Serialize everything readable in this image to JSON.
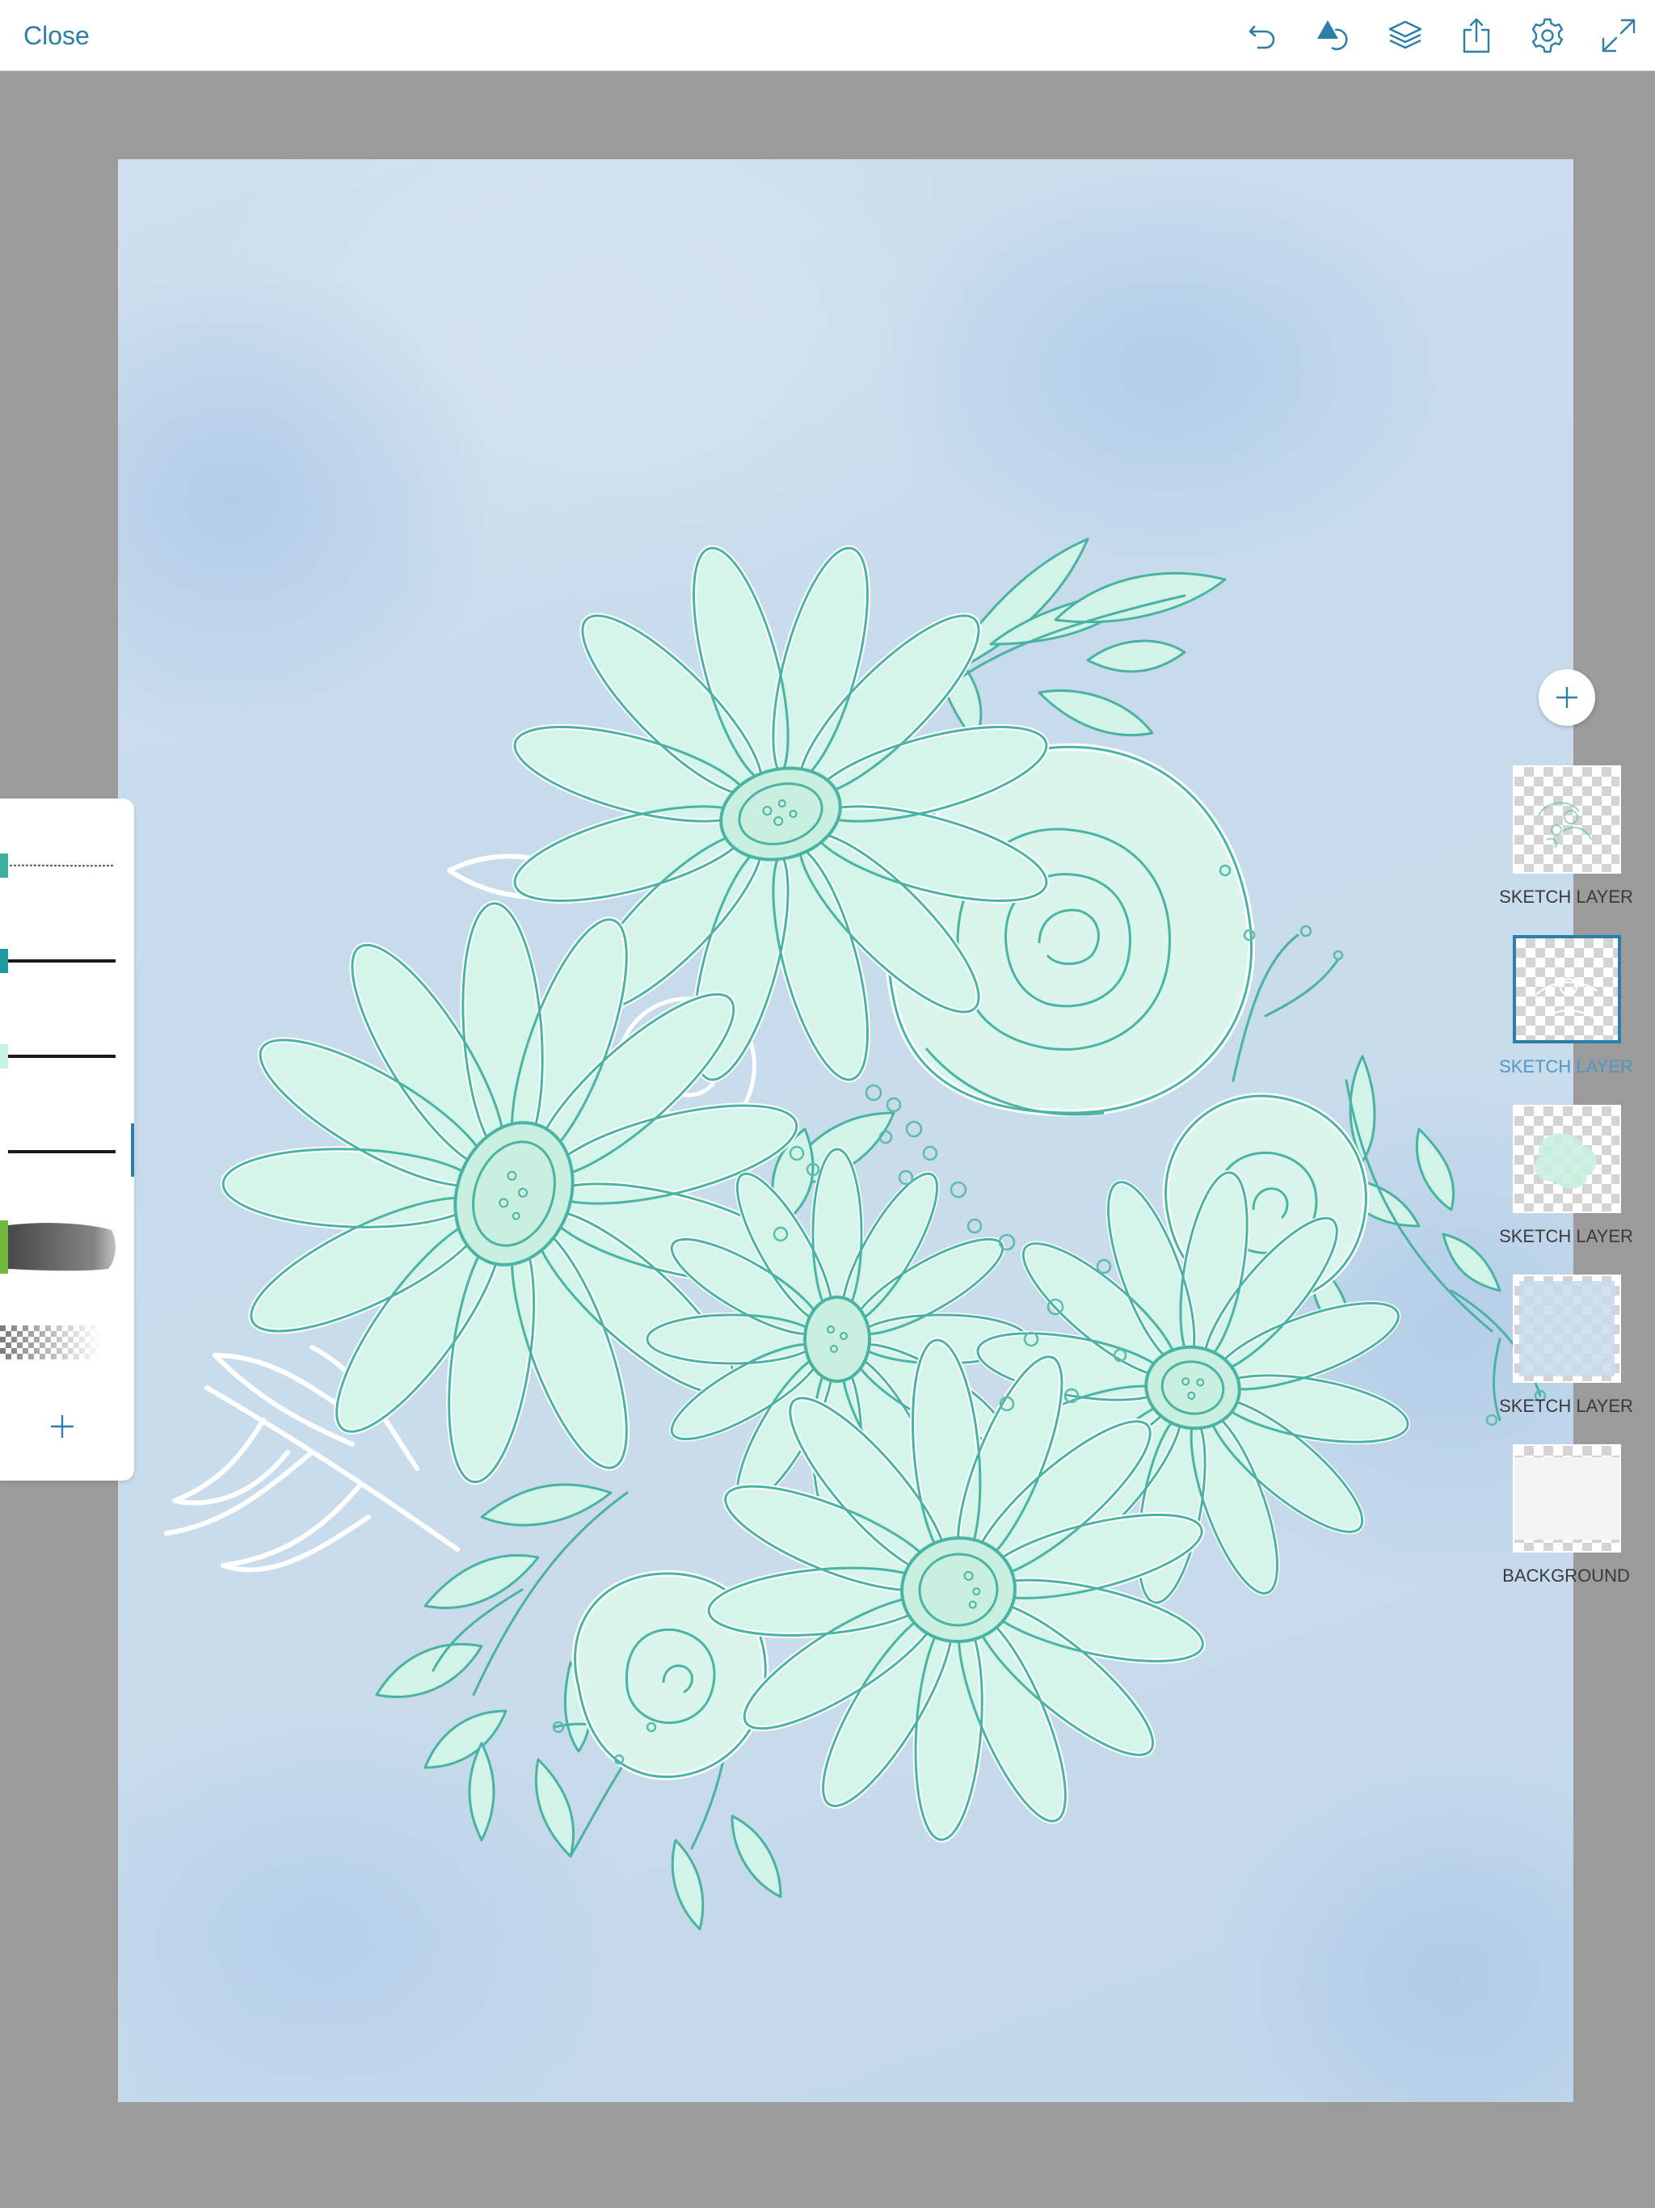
{
  "header": {
    "close_label": "Close",
    "tools": [
      "undo-icon",
      "shapes-icon",
      "layers-icon",
      "share-icon",
      "settings-icon",
      "fullscreen-icon"
    ]
  },
  "brush_panel": {
    "brushes": [
      {
        "icon": "pencil-brush",
        "color": "#3bb0a0"
      },
      {
        "icon": "ink-brush",
        "color": "#1f9aa3"
      },
      {
        "icon": "ink-brush",
        "color": "#c8f3ea"
      },
      {
        "icon": "ink-brush",
        "color": "#ffffff"
      },
      {
        "icon": "watercolor-brush",
        "color": "#6fb83a"
      },
      {
        "icon": "eraser-brush",
        "color": "#ffffff"
      }
    ],
    "selected_index": 3,
    "add_label": "+"
  },
  "layers": {
    "add_label": "+",
    "items": [
      {
        "label": "SKETCH LAYER",
        "selected": false
      },
      {
        "label": "SKETCH LAYER",
        "selected": true
      },
      {
        "label": "SKETCH LAYER",
        "selected": false
      },
      {
        "label": "SKETCH LAYER",
        "selected": false
      },
      {
        "label": "BACKGROUND",
        "selected": false
      }
    ]
  },
  "colors": {
    "accent": "#2d7ea8",
    "line_art": "#3fb3a0",
    "flower_fill": "#d9f6ec",
    "canvas_bg": "#c8dbed",
    "workspace": "#9b9b9b"
  }
}
